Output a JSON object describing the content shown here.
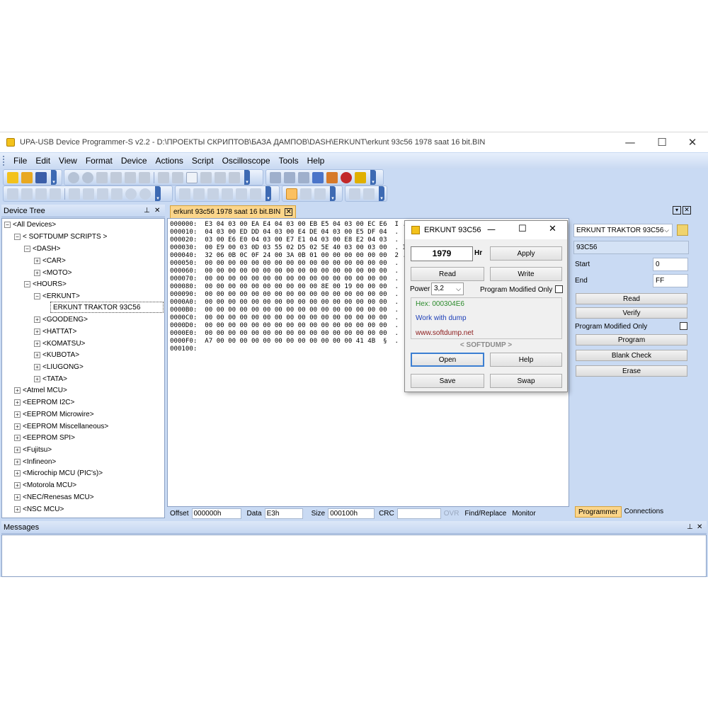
{
  "window": {
    "title": "UPA-USB Device Programmer-S v2.2 - D:\\ПРОЕКТЫ СКРИПТОВ\\БАЗА ДАМПОВ\\DASH\\ERKUNT\\erkunt 93c56 1978 saat 16 bit.BIN",
    "minimize": "—",
    "maximize": "☐",
    "close": "✕"
  },
  "menu": [
    "File",
    "Edit",
    "View",
    "Format",
    "Device",
    "Actions",
    "Script",
    "Oscilloscope",
    "Tools",
    "Help"
  ],
  "toolbar1_icons": [
    "new-icon",
    "open-icon",
    "save-icon",
    "undo-icon",
    "redo-icon",
    "cut-icon",
    "copy-icon",
    "paste-icon",
    "delete-icon",
    "find-icon",
    "replace-icon",
    "fill-icon",
    "checksum-icon",
    "dump-icon",
    "device-icon",
    "info-icon",
    "chip-icon",
    "bug-icon",
    "sigma-icon"
  ],
  "device_tree": {
    "title": "Device Tree",
    "pin": "⊥",
    "close": "✕",
    "nodes": [
      {
        "label": "<All Devices>",
        "sign": "−"
      },
      {
        "label": "< SOFTDUMP SCRIPTS >",
        "sign": "−"
      },
      {
        "label": "<DASH>",
        "sign": "−"
      },
      {
        "label": "<CAR>",
        "sign": "+"
      },
      {
        "label": "<MOTO>",
        "sign": "+"
      },
      {
        "label": "<HOURS>",
        "sign": "−"
      },
      {
        "label": "<ERKUNT>",
        "sign": "−"
      },
      {
        "label": "ERKUNT TRAKTOR 93C56",
        "sign": ""
      },
      {
        "label": "<GOODENG>",
        "sign": "+"
      },
      {
        "label": "<HATTAT>",
        "sign": "+"
      },
      {
        "label": "<KOMATSU>",
        "sign": "+"
      },
      {
        "label": "<KUBOTA>",
        "sign": "+"
      },
      {
        "label": "<LIUGONG>",
        "sign": "+"
      },
      {
        "label": "<TATA>",
        "sign": "+"
      },
      {
        "label": "<Atmel MCU>",
        "sign": "+"
      },
      {
        "label": "<EEPROM I2C>",
        "sign": "+"
      },
      {
        "label": "<EEPROM Microwire>",
        "sign": "+"
      },
      {
        "label": "<EEPROM Miscellaneous>",
        "sign": "+"
      },
      {
        "label": "<EEPROM SPI>",
        "sign": "+"
      },
      {
        "label": "<Fujitsu>",
        "sign": "+"
      },
      {
        "label": "<Infineon>",
        "sign": "+"
      },
      {
        "label": "<Microchip MCU (PIC's)>",
        "sign": "+"
      },
      {
        "label": "<Motorola MCU>",
        "sign": "+"
      },
      {
        "label": "<NEC/Renesas MCU>",
        "sign": "+"
      },
      {
        "label": "<NSC MCU>",
        "sign": "+"
      }
    ]
  },
  "editor_tab": {
    "label": "erkunt 93c56 1978 saat 16 bit.BIN",
    "close": "✕"
  },
  "hex_rows": [
    "000000:  E3 04 03 00 EA E4 04 03 00 EB E5 04 03 00 EC E6  I .",
    "000010:  04 03 00 ED DD 04 03 00 E4 DE 04 03 00 E5 DF 04  .",
    "000020:  03 00 E6 E0 04 03 00 E7 E1 04 03 00 E8 E2 04 03  .",
    "000030:  00 E9 00 03 0D 03 55 02 D5 02 5E 40 03 00 03 00  . I",
    "000040:  32 06 0B 0C 0F 24 00 3A 0B 01 00 00 00 00 00 00  2 .",
    "000050:  00 00 00 00 00 00 00 00 00 00 00 00 00 00 00 00  .",
    "000060:  00 00 00 00 00 00 00 00 00 00 00 00 00 00 00 00  .",
    "000070:  00 00 00 00 00 00 00 00 00 00 00 00 00 00 00 00  .",
    "000080:  00 00 00 00 00 00 00 00 00 00 8E 00 19 00 00 00  .",
    "000090:  00 00 00 00 00 00 00 00 00 00 00 00 00 00 00 00  .",
    "0000A0:  00 00 00 00 00 00 00 00 00 00 00 00 00 00 00 00  .",
    "0000B0:  00 00 00 00 00 00 00 00 00 00 00 00 00 00 00 00  .",
    "0000C0:  00 00 00 00 00 00 00 00 00 00 00 00 00 00 00 00  .",
    "0000D0:  00 00 00 00 00 00 00 00 00 00 00 00 00 00 00 00  .",
    "0000E0:  00 00 00 00 00 00 00 00 00 00 00 00 00 00 00 00  .",
    "0000F0:  A7 00 00 00 00 00 00 00 00 00 00 00 00 41 4B  §  .",
    "000100:"
  ],
  "statusbar": {
    "offset_label": "Offset",
    "offset_value": "000000h",
    "data_label": "Data",
    "data_value": "E3h",
    "size_label": "Size",
    "size_value": "000100h",
    "crc_label": "CRC",
    "crc_value": "",
    "ovr": "OVR",
    "find_replace": "Find/Replace",
    "monitor": "Monitor"
  },
  "right_panel": {
    "device_select": "ERKUNT TRAKTOR 93C56",
    "chip": "93C56",
    "start_label": "Start",
    "start_value": "0",
    "end_label": "End",
    "end_value": "FF",
    "read": "Read",
    "verify": "Verify",
    "program_modified_only": "Program Modified Only",
    "program": "Program",
    "blank_check": "Blank Check",
    "erase": "Erase"
  },
  "bottom_tabs": {
    "programmer": "Programmer",
    "connections": "Connections"
  },
  "messages": {
    "title": "Messages",
    "pin": "⊥",
    "close": "✕"
  },
  "dialog": {
    "title": "ERKUNT 93C56",
    "minimize": "—",
    "maximize": "☐",
    "close": "✕",
    "value": "1979",
    "unit": "Hr",
    "apply": "Apply",
    "read": "Read",
    "write": "Write",
    "power_label": "Power",
    "power_value": "3,2",
    "program_modified_only": "Program Modified Only",
    "hex_text": "Hex: 000304E6",
    "work_text": "Work with dump",
    "site_text": "www.softdump.net",
    "brand": "< SOFTDUMP >",
    "open": "Open",
    "help": "Help",
    "save": "Save",
    "swap": "Swap"
  },
  "colors": {
    "accent": "#3d6ab3",
    "tab": "#fbd58a",
    "panel": "#c9daf3",
    "hex_green": "#2a8a2a",
    "hex_blue": "#1d3fb8",
    "site_red": "#8b1a1a"
  }
}
